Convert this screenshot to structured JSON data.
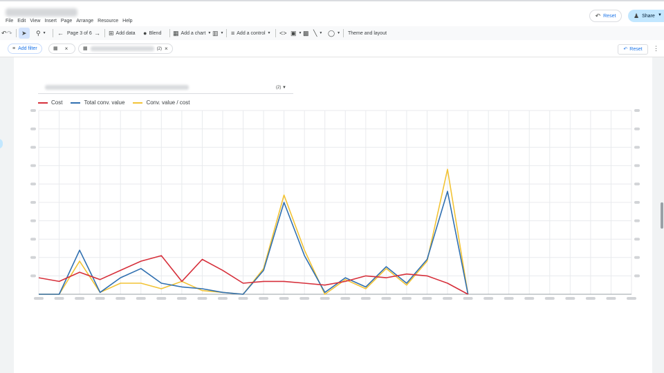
{
  "menu": [
    "File",
    "Edit",
    "View",
    "Insert",
    "Page",
    "Arrange",
    "Resource",
    "Help"
  ],
  "header": {
    "reset_label": "Reset",
    "share_label": "Share"
  },
  "toolbar": {
    "page_label": "Page 3 of 6",
    "add_data": "Add data",
    "blend": "Blend",
    "add_chart": "Add a chart",
    "add_control": "Add a control",
    "theme_layout": "Theme and layout"
  },
  "filterbar": {
    "add_filter": "Add filter",
    "chip2_count": "(2)",
    "reset_label": "Reset"
  },
  "control": {
    "count": "(2)"
  },
  "colors": {
    "cost": "#d62f3a",
    "total_conv": "#2f6fb0",
    "ratio": "#f2c335",
    "accent": "#1a73e8"
  },
  "chart_data": {
    "type": "line",
    "x_count": 30,
    "ylim": [
      0,
      100
    ],
    "grid": true,
    "legend": "top-left",
    "series": [
      {
        "name": "Cost",
        "values": [
          9,
          7,
          12,
          8,
          13,
          18,
          21,
          7,
          19,
          13,
          6,
          7,
          7,
          6,
          5,
          7,
          10,
          9,
          11,
          10,
          6,
          0
        ]
      },
      {
        "name": "Total conv. value",
        "values": [
          0,
          0,
          24,
          1,
          9,
          14,
          6,
          4,
          3,
          1,
          0,
          13,
          50,
          21,
          1,
          9,
          4,
          15,
          6,
          19,
          56,
          0
        ]
      },
      {
        "name": "Conv. value / cost",
        "values": [
          0,
          0,
          18,
          1,
          6,
          6,
          3,
          7,
          2,
          1,
          0,
          14,
          54,
          24,
          0,
          8,
          3,
          14,
          5,
          18,
          68,
          0
        ]
      }
    ]
  }
}
